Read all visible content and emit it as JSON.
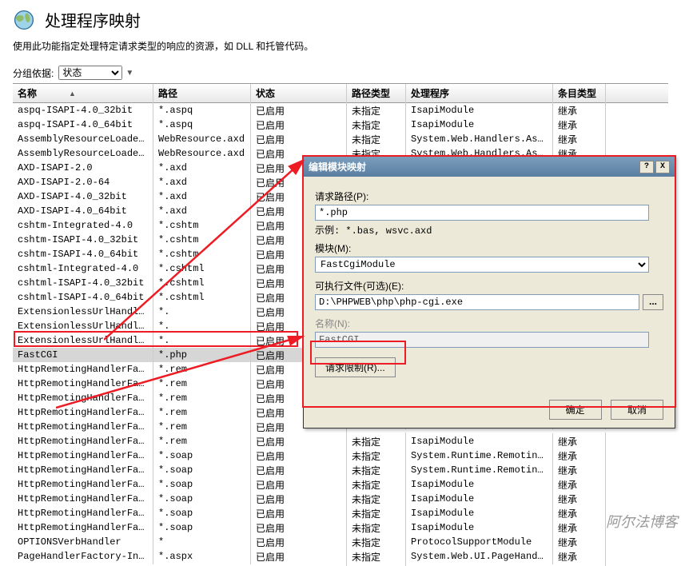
{
  "header": {
    "title": "处理程序映射"
  },
  "subtitle": "使用此功能指定处理特定请求类型的响应的资源，如 DLL 和托管代码。",
  "group": {
    "label": "分组依据:",
    "value": "状态"
  },
  "columns": {
    "name": "名称",
    "path": "路径",
    "state": "状态",
    "ptype": "路径类型",
    "handler": "处理程序",
    "etype": "条目类型"
  },
  "rows": [
    {
      "name": "aspq-ISAPI-4.0_32bit",
      "path": "*.aspq",
      "state": "已启用",
      "ptype": "未指定",
      "handler": "IsapiModule",
      "etype": "继承"
    },
    {
      "name": "aspq-ISAPI-4.0_64bit",
      "path": "*.aspq",
      "state": "已启用",
      "ptype": "未指定",
      "handler": "IsapiModule",
      "etype": "继承"
    },
    {
      "name": "AssemblyResourceLoader-In...",
      "path": "WebResource.axd",
      "state": "已启用",
      "ptype": "未指定",
      "handler": "System.Web.Handlers.Assem...",
      "etype": "继承"
    },
    {
      "name": "AssemblyResourceLoader-In...",
      "path": "WebResource.axd",
      "state": "已启用",
      "ptype": "未指定",
      "handler": "System.Web.Handlers.Assem...",
      "etype": "继承"
    },
    {
      "name": "AXD-ISAPI-2.0",
      "path": "*.axd",
      "state": "已启用",
      "ptype": "",
      "handler": "",
      "etype": ""
    },
    {
      "name": "AXD-ISAPI-2.0-64",
      "path": "*.axd",
      "state": "已启用",
      "ptype": "",
      "handler": "",
      "etype": ""
    },
    {
      "name": "AXD-ISAPI-4.0_32bit",
      "path": "*.axd",
      "state": "已启用",
      "ptype": "",
      "handler": "",
      "etype": ""
    },
    {
      "name": "AXD-ISAPI-4.0_64bit",
      "path": "*.axd",
      "state": "已启用",
      "ptype": "",
      "handler": "",
      "etype": ""
    },
    {
      "name": "cshtm-Integrated-4.0",
      "path": "*.cshtm",
      "state": "已启用",
      "ptype": "",
      "handler": "",
      "etype": ""
    },
    {
      "name": "cshtm-ISAPI-4.0_32bit",
      "path": "*.cshtm",
      "state": "已启用",
      "ptype": "",
      "handler": "",
      "etype": ""
    },
    {
      "name": "cshtm-ISAPI-4.0_64bit",
      "path": "*.cshtm",
      "state": "已启用",
      "ptype": "",
      "handler": "",
      "etype": ""
    },
    {
      "name": "cshtml-Integrated-4.0",
      "path": "*.cshtml",
      "state": "已启用",
      "ptype": "",
      "handler": "",
      "etype": ""
    },
    {
      "name": "cshtml-ISAPI-4.0_32bit",
      "path": "*.cshtml",
      "state": "已启用",
      "ptype": "",
      "handler": "",
      "etype": ""
    },
    {
      "name": "cshtml-ISAPI-4.0_64bit",
      "path": "*.cshtml",
      "state": "已启用",
      "ptype": "",
      "handler": "",
      "etype": ""
    },
    {
      "name": "ExtensionlessUrlHandler-I...",
      "path": "*.",
      "state": "已启用",
      "ptype": "",
      "handler": "",
      "etype": ""
    },
    {
      "name": "ExtensionlessUrlHandler-I...",
      "path": "*.",
      "state": "已启用",
      "ptype": "",
      "handler": "",
      "etype": ""
    },
    {
      "name": "ExtensionlessUrlHandler-I...",
      "path": "*.",
      "state": "已启用",
      "ptype": "",
      "handler": "",
      "etype": ""
    },
    {
      "name": "FastCGI",
      "path": "*.php",
      "state": "已启用",
      "ptype": "",
      "handler": "",
      "etype": "",
      "selected": true
    },
    {
      "name": "HttpRemotingHandlerFactor...",
      "path": "*.rem",
      "state": "已启用",
      "ptype": "",
      "handler": "",
      "etype": ""
    },
    {
      "name": "HttpRemotingHandlerFactor...",
      "path": "*.rem",
      "state": "已启用",
      "ptype": "",
      "handler": "",
      "etype": ""
    },
    {
      "name": "HttpRemotingHandlerFactor...",
      "path": "*.rem",
      "state": "已启用",
      "ptype": "",
      "handler": "",
      "etype": ""
    },
    {
      "name": "HttpRemotingHandlerFactor...",
      "path": "*.rem",
      "state": "已启用",
      "ptype": "",
      "handler": "",
      "etype": ""
    },
    {
      "name": "HttpRemotingHandlerFactor...",
      "path": "*.rem",
      "state": "已启用",
      "ptype": "",
      "handler": "",
      "etype": ""
    },
    {
      "name": "HttpRemotingHandlerFactor...",
      "path": "*.rem",
      "state": "已启用",
      "ptype": "未指定",
      "handler": "IsapiModule",
      "etype": "继承"
    },
    {
      "name": "HttpRemotingHandlerFactor...",
      "path": "*.soap",
      "state": "已启用",
      "ptype": "未指定",
      "handler": "System.Runtime.Remoting.C...",
      "etype": "继承"
    },
    {
      "name": "HttpRemotingHandlerFactor...",
      "path": "*.soap",
      "state": "已启用",
      "ptype": "未指定",
      "handler": "System.Runtime.Remoting.C...",
      "etype": "继承"
    },
    {
      "name": "HttpRemotingHandlerFactor...",
      "path": "*.soap",
      "state": "已启用",
      "ptype": "未指定",
      "handler": "IsapiModule",
      "etype": "继承"
    },
    {
      "name": "HttpRemotingHandlerFactor...",
      "path": "*.soap",
      "state": "已启用",
      "ptype": "未指定",
      "handler": "IsapiModule",
      "etype": "继承"
    },
    {
      "name": "HttpRemotingHandlerFactor...",
      "path": "*.soap",
      "state": "已启用",
      "ptype": "未指定",
      "handler": "IsapiModule",
      "etype": "继承"
    },
    {
      "name": "HttpRemotingHandlerFactor...",
      "path": "*.soap",
      "state": "已启用",
      "ptype": "未指定",
      "handler": "IsapiModule",
      "etype": "继承"
    },
    {
      "name": "OPTIONSVerbHandler",
      "path": "*",
      "state": "已启用",
      "ptype": "未指定",
      "handler": "ProtocolSupportModule",
      "etype": "继承"
    },
    {
      "name": "PageHandlerFactory-Integr...",
      "path": "*.aspx",
      "state": "已启用",
      "ptype": "未指定",
      "handler": "System.Web.UI.PageHandler...",
      "etype": "继承"
    }
  ],
  "dialog": {
    "title": "编辑模块映射",
    "help": "?",
    "close": "X",
    "path_label": "请求路径(P):",
    "path_value": "*.php",
    "path_hint": "示例: *.bas, wsvc.axd",
    "module_label": "模块(M):",
    "module_value": "FastCgiModule",
    "exec_label": "可执行文件(可选)(E):",
    "exec_value": "D:\\PHPWEB\\php\\php-cgi.exe",
    "browse": "...",
    "name_label": "名称(N):",
    "name_value": "FastCGI",
    "req_limit": "请求限制(R)...",
    "ok": "确定",
    "cancel": "取消"
  },
  "watermark": "阿尔法博客"
}
